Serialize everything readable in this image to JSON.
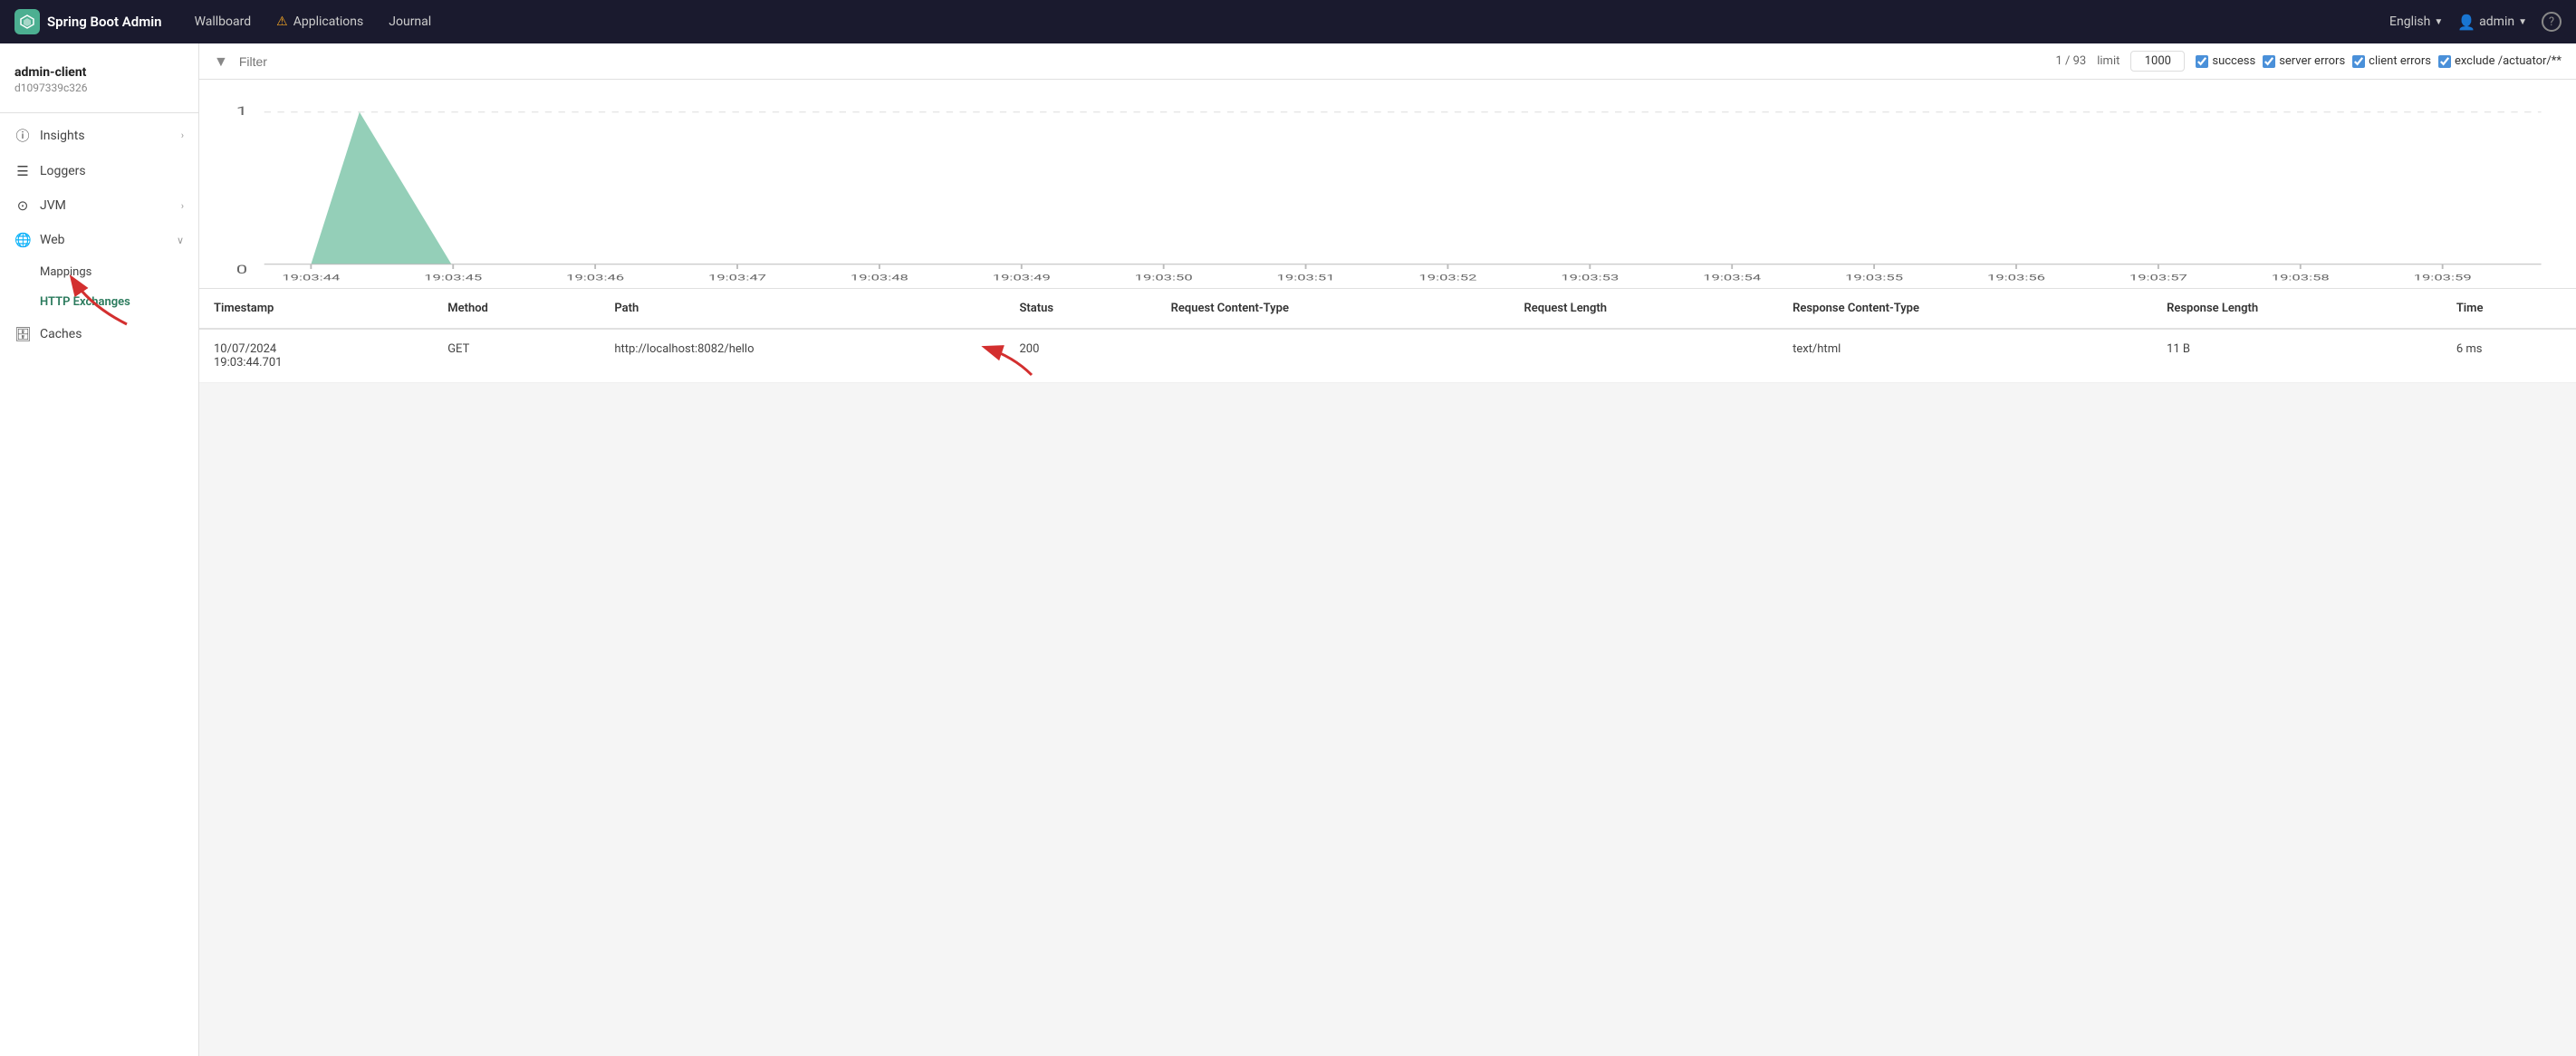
{
  "brand": {
    "name": "Spring Boot Admin"
  },
  "nav": {
    "links": [
      {
        "id": "wallboard",
        "label": "Wallboard",
        "has_warning": false
      },
      {
        "id": "applications",
        "label": "Applications",
        "has_warning": true
      },
      {
        "id": "journal",
        "label": "Journal",
        "has_warning": false
      }
    ],
    "language": "English",
    "user": "admin",
    "help_title": "?"
  },
  "sidebar": {
    "client_name": "admin-client",
    "client_id": "d1097339c326",
    "items": [
      {
        "id": "insights",
        "label": "Insights",
        "icon": "ⓘ",
        "has_chevron": true,
        "expanded": false
      },
      {
        "id": "loggers",
        "label": "Loggers",
        "icon": "📋",
        "has_chevron": false
      },
      {
        "id": "jvm",
        "label": "JVM",
        "icon": "⊙",
        "has_chevron": true,
        "expanded": false
      },
      {
        "id": "web",
        "label": "Web",
        "icon": "🌐",
        "has_chevron": true,
        "expanded": true
      }
    ],
    "sub_items": [
      {
        "id": "mappings",
        "label": "Mappings",
        "parent": "web"
      },
      {
        "id": "http-exchanges",
        "label": "HTTP Exchanges",
        "parent": "web",
        "active": true
      }
    ],
    "bottom_items": [
      {
        "id": "caches",
        "label": "Caches",
        "icon": "🗄"
      }
    ]
  },
  "filter_bar": {
    "placeholder": "Filter",
    "count": "1 / 93",
    "limit_label": "limit",
    "limit_value": "1000",
    "checkboxes": [
      {
        "id": "success",
        "label": "success",
        "checked": true
      },
      {
        "id": "server-errors",
        "label": "server errors",
        "checked": true
      },
      {
        "id": "client-errors",
        "label": "client errors",
        "checked": true
      },
      {
        "id": "exclude-actuator",
        "label": "exclude /actuator/**",
        "checked": true
      }
    ]
  },
  "chart": {
    "y_max": 1,
    "y_min": 0,
    "x_labels": [
      "19:03:44",
      "19:03:45",
      "19:03:46",
      "19:03:47",
      "19:03:48",
      "19:03:49",
      "19:03:50",
      "19:03:51",
      "19:03:52",
      "19:03:53",
      "19:03:54",
      "19:03:55",
      "19:03:56",
      "19:03:57",
      "19:03:58",
      "19:03:59"
    ],
    "peak_label": "1",
    "zero_label": "0"
  },
  "table": {
    "headers": [
      "Timestamp",
      "Method",
      "Path",
      "Status",
      "Request Content-Type",
      "Request Length",
      "Response Content-Type",
      "Response Length",
      "Time"
    ],
    "rows": [
      {
        "timestamp": "10/07/2024\n19:03:44.701",
        "method": "GET",
        "path": "http://localhost:8082/hello",
        "status": "200",
        "request_content_type": "",
        "request_length": "",
        "response_content_type": "text/html",
        "response_length": "11 B",
        "time": "6 ms"
      }
    ]
  }
}
